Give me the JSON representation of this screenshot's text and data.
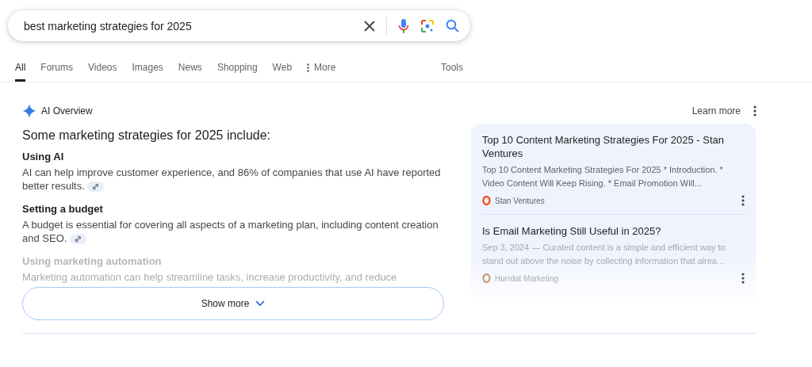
{
  "search": {
    "value": "best marketing strategies for 2025"
  },
  "tabs": [
    {
      "label": "All",
      "selected": true
    },
    {
      "label": "Forums",
      "selected": false
    },
    {
      "label": "Videos",
      "selected": false
    },
    {
      "label": "Images",
      "selected": false
    },
    {
      "label": "News",
      "selected": false
    },
    {
      "label": "Shopping",
      "selected": false
    },
    {
      "label": "Web",
      "selected": false
    },
    {
      "label": "More",
      "selected": false,
      "kind": "menu"
    }
  ],
  "tools_label": "Tools",
  "ai_overview": {
    "title": "AI Overview",
    "learn_more": "Learn more",
    "intro": "Some marketing strategies for 2025 include:",
    "items": [
      {
        "heading": "Using AI",
        "text": "AI can help improve customer experience, and 86% of companies that use AI have reported better results.",
        "link": true,
        "faded": false
      },
      {
        "heading": "Setting a budget",
        "text": "A budget is essential for covering all aspects of a marketing plan, including content creation and SEO.",
        "link": true,
        "faded": false
      },
      {
        "heading": "Using marketing automation",
        "text": "Marketing automation can help streamline tasks, increase productivity, and reduce",
        "link": false,
        "faded": true
      }
    ],
    "sources": [
      {
        "title": "Top 10 Content Marketing Strategies For 2025 - Stan Ventures",
        "snippet": "Top 10 Content Marketing Strategies For 2025 * Introduction. * Video Content Will Keep Rising. * Email Promotion Will...",
        "site": "Stan Ventures",
        "color": "#f4511e",
        "faded": false
      },
      {
        "title": "Is Email Marketing Still Useful in 2025?",
        "snippet": "Sep 3, 2024 — Curated content is a simple and efficient way to stand out above the noise by collecting information that alrea...",
        "site": "Hurrdat Marketing",
        "color": "#c9a27a",
        "faded": true
      }
    ],
    "show_more": "Show more"
  }
}
